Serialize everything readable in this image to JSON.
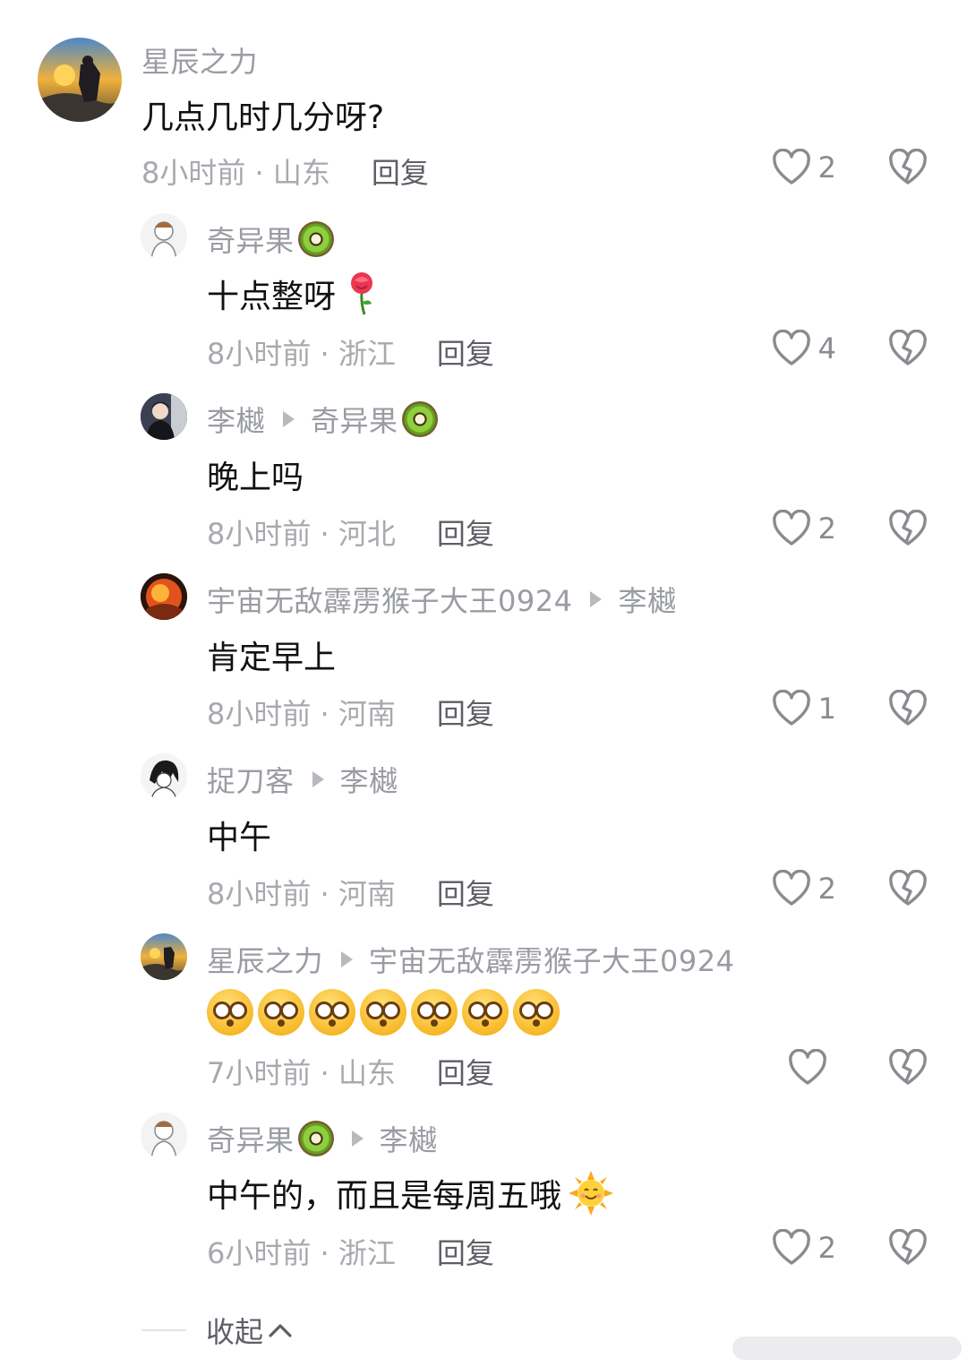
{
  "comments": [
    {
      "user": "星辰之力",
      "text": "几点几时几分呀?",
      "time": "8小时前 · 山东",
      "reply": "回复",
      "likes": "2"
    },
    {
      "user": "奇异果",
      "emoji": "kiwi-icon",
      "text": "十点整呀",
      "text_emoji": "rose",
      "time": "8小时前 · 浙江",
      "reply": "回复",
      "likes": "4"
    },
    {
      "user": "李樾",
      "to": "奇异果",
      "to_emoji": "kiwi-icon",
      "text": "晚上吗",
      "time": "8小时前 · 河北",
      "reply": "回复",
      "likes": "2"
    },
    {
      "user": "宇宙无敌霹雳猴子大王0924",
      "to": "李樾",
      "text": "肯定早上",
      "time": "8小时前 · 河南",
      "reply": "回复",
      "likes": "1"
    },
    {
      "user": "捉刀客",
      "to": "李樾",
      "text": "中午",
      "time": "8小时前 · 河南",
      "reply": "回复",
      "likes": "2"
    },
    {
      "user": "星辰之力",
      "to": "宇宙无敌霹雳猴子大王0924",
      "text": "",
      "text_emoji": "dizzy-face x7",
      "time": "7小时前 · 山东",
      "reply": "回复",
      "likes": ""
    },
    {
      "user": "奇异果",
      "emoji": "kiwi-icon",
      "to": "李樾",
      "text": "中午的，而且是每周五哦",
      "text_emoji": "sun-with-face",
      "time": "6小时前 · 浙江",
      "reply": "回复",
      "likes": "2"
    }
  ],
  "collapse_label": "收起",
  "icons": {
    "like": "heart-icon",
    "dislike": "broken-heart-icon",
    "collapse": "chevron-up-icon"
  },
  "colors": {
    "name": "#9a9ca3",
    "meta": "#a7a9ae",
    "reply": "#5d5f66",
    "text": "#111111"
  }
}
